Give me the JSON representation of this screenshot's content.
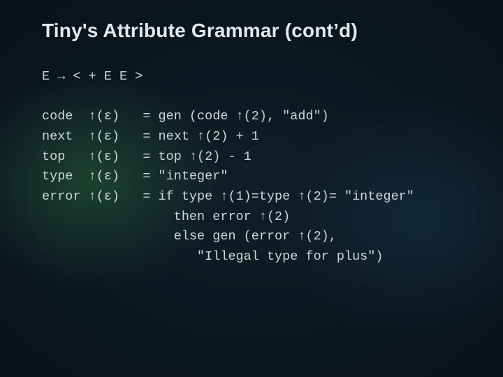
{
  "title": "Tiny's Attribute Grammar (cont’d)",
  "production": "E → < + E E >",
  "rules": [
    {
      "attr": "code",
      "arg": "↑(ε)",
      "rhs_lines": [
        "gen (code ↑(2), \"add\")"
      ]
    },
    {
      "attr": "next",
      "arg": "↑(ε)",
      "rhs_lines": [
        "next ↑(2) + 1"
      ]
    },
    {
      "attr": "top",
      "arg": "↑(ε)",
      "rhs_lines": [
        "top ↑(2) - 1"
      ]
    },
    {
      "attr": "type",
      "arg": "↑(ε)",
      "rhs_lines": [
        "\"integer\""
      ]
    },
    {
      "attr": "error",
      "arg": "↑(ε)",
      "rhs_lines": [
        "if type ↑(1)=type ↑(2)= \"integer\"",
        "  then error ↑(2)",
        "  else gen (error ↑(2),",
        "     \"Illegal type for plus\")"
      ]
    }
  ]
}
